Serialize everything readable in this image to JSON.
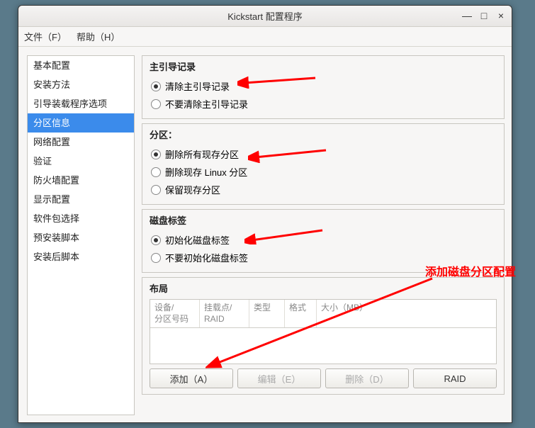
{
  "window": {
    "title": "Kickstart 配置程序"
  },
  "menu": {
    "file": "文件（F）",
    "help": "帮助（H）"
  },
  "sidebar": {
    "items": [
      "基本配置",
      "安装方法",
      "引导装载程序选项",
      "分区信息",
      "网络配置",
      "验证",
      "防火墙配置",
      "显示配置",
      "软件包选择",
      "预安装脚本",
      "安装后脚本"
    ],
    "selected_index": 3
  },
  "groups": {
    "mbr": {
      "title": "主引导记录",
      "options": [
        "清除主引导记录",
        "不要清除主引导记录"
      ],
      "selected": 0
    },
    "partition": {
      "title": "分区：",
      "options": [
        "删除所有现存分区",
        "删除现存 Linux 分区",
        "保留现存分区"
      ],
      "selected": 0
    },
    "disklabel": {
      "title": "磁盘标签",
      "options": [
        "初始化磁盘标签",
        "不要初始化磁盘标签"
      ],
      "selected": 0
    },
    "layout": {
      "title": "布局",
      "columns": [
        "设备/\n分区号码",
        "挂载点/\nRAID",
        "类型",
        "格式",
        "大小（MB）"
      ],
      "buttons": {
        "add": "添加（A）",
        "edit": "编辑（E）",
        "delete": "删除（D）",
        "raid": "RAID"
      }
    }
  },
  "annotation": "添加磁盘分区配置"
}
